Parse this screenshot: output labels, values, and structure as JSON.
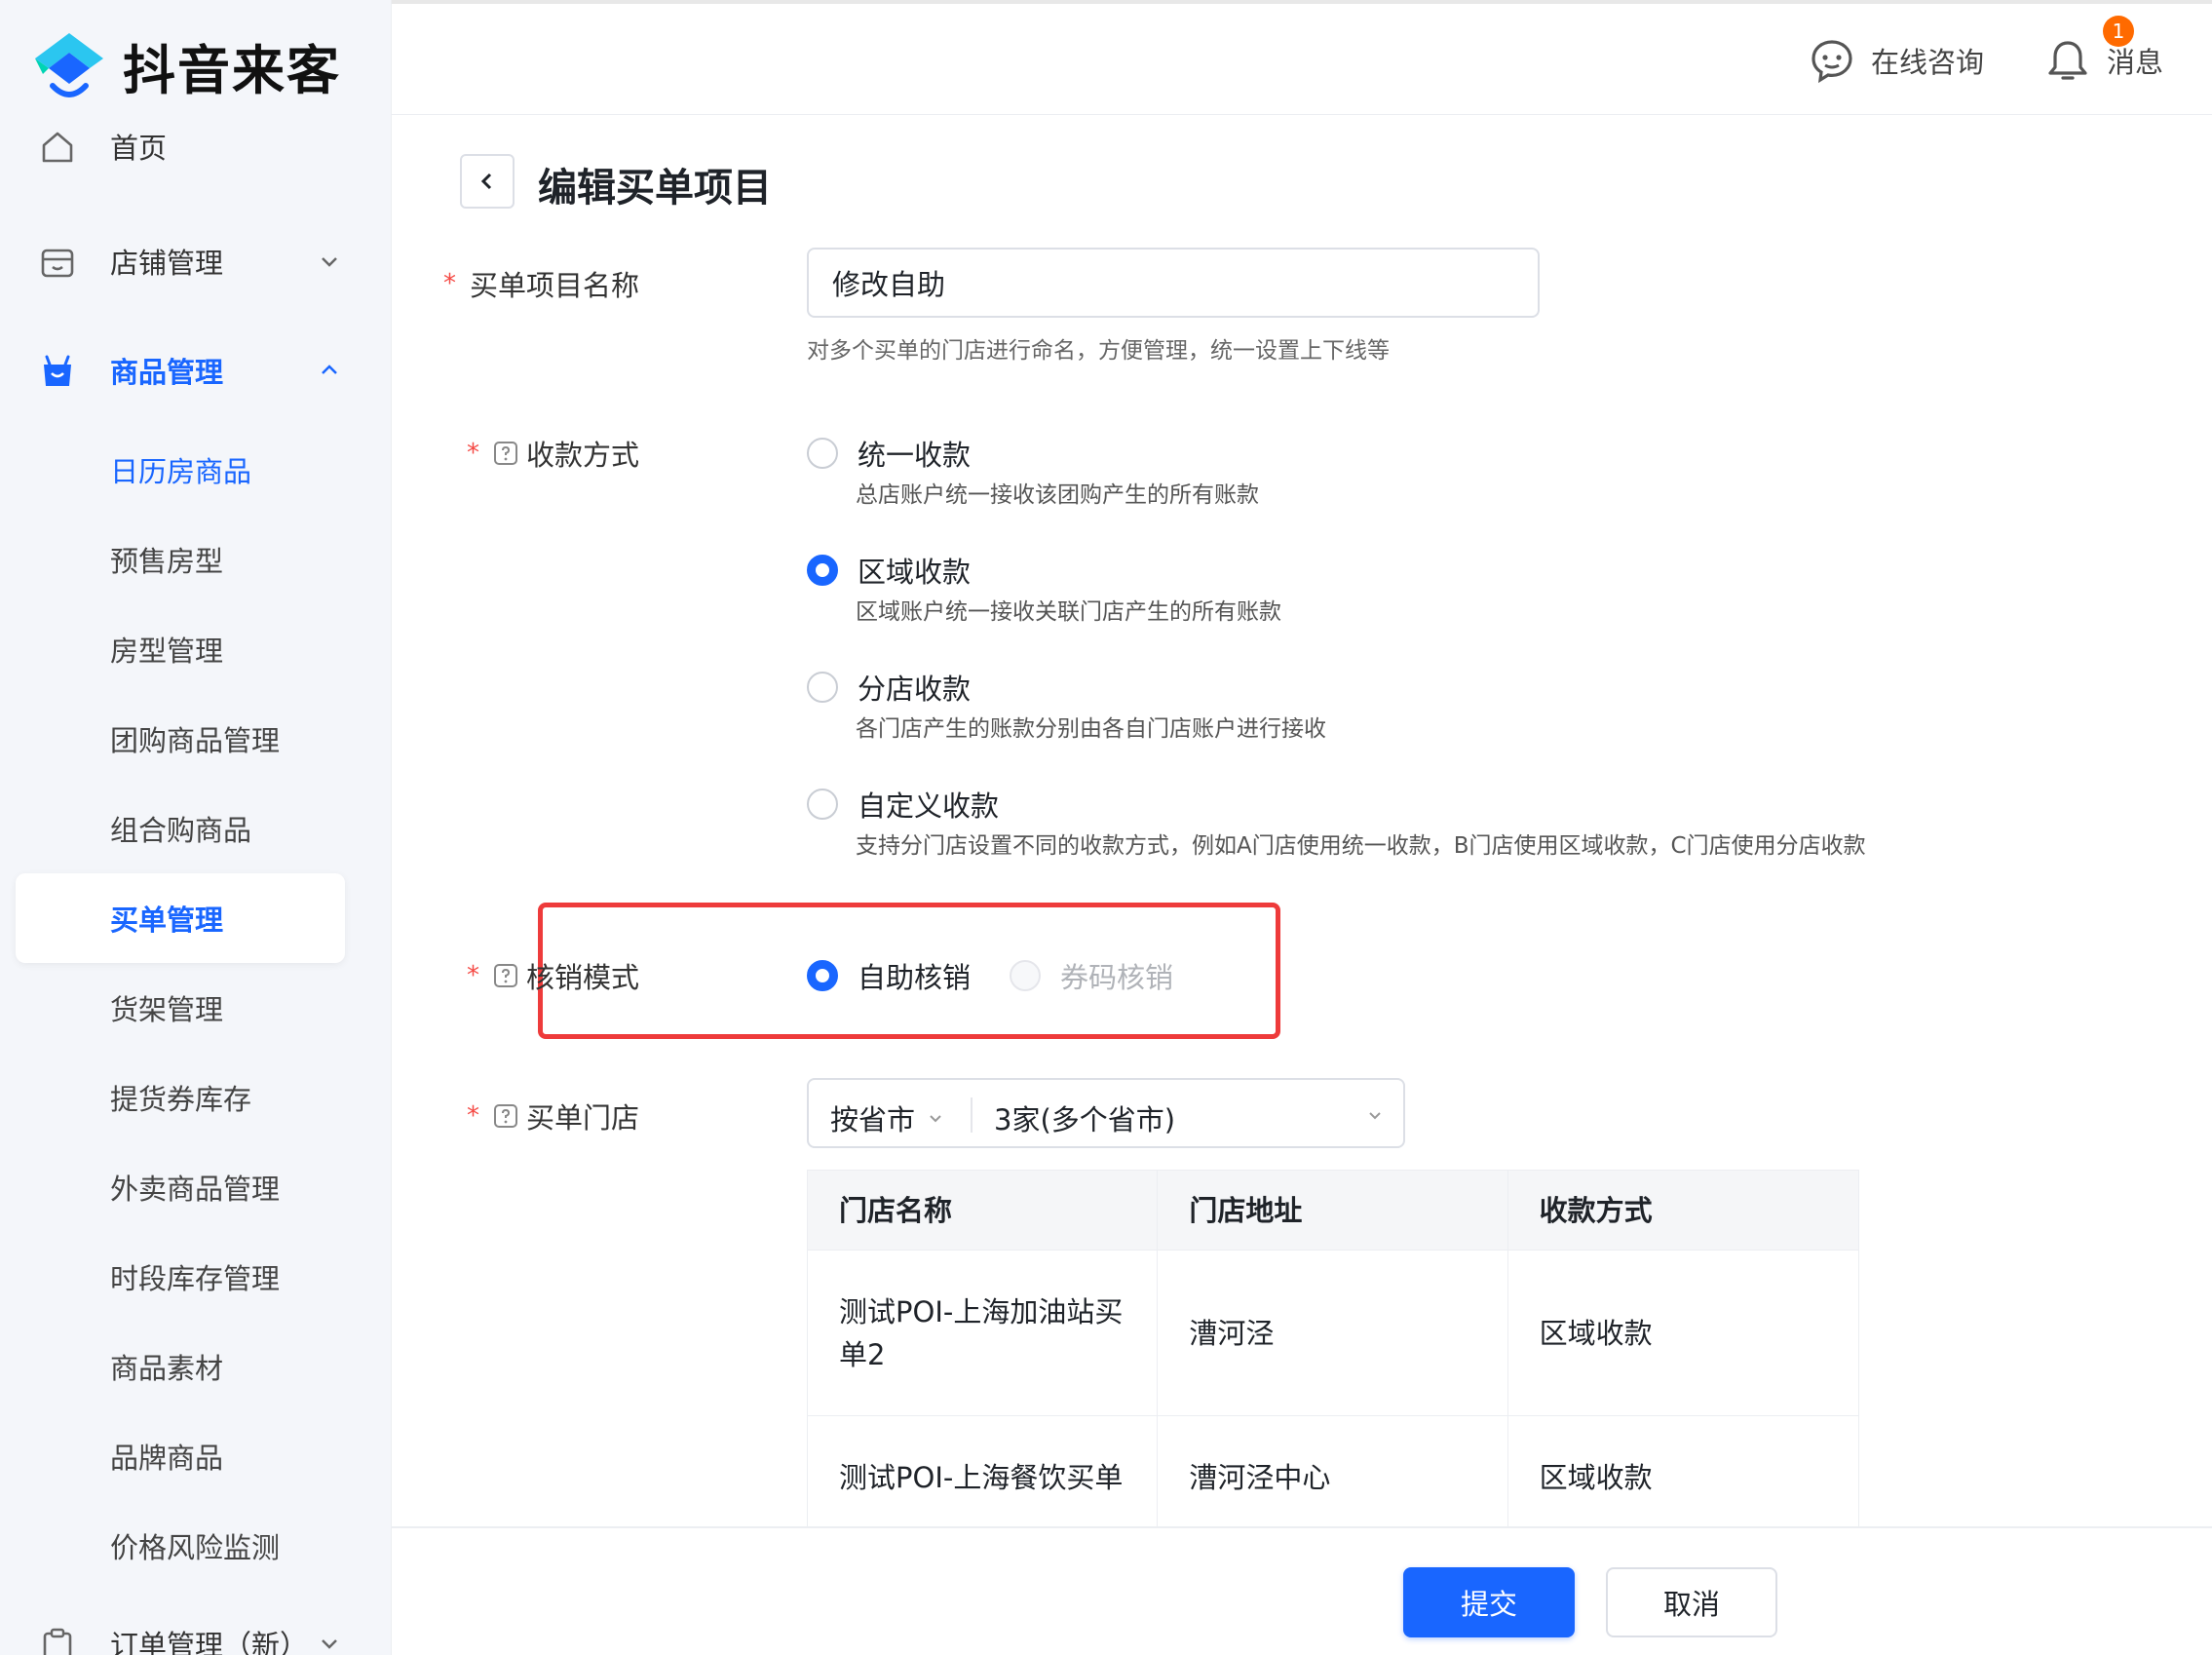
{
  "brand": {
    "name": "抖音来客"
  },
  "sidebar": {
    "items": [
      {
        "label": "首页",
        "icon": "home-icon"
      },
      {
        "label": "店铺管理",
        "icon": "store-icon"
      },
      {
        "label": "商品管理",
        "icon": "goods-bag-icon"
      }
    ],
    "sub_items": [
      "日历房商品",
      "预售房型",
      "房型管理",
      "团购商品管理",
      "组合购商品",
      "买单管理",
      "货架管理",
      "提货券库存",
      "外卖商品管理",
      "时段库存管理",
      "商品素材",
      "品牌商品",
      "价格风险监测"
    ],
    "order_item": {
      "label": "订单管理（新）"
    }
  },
  "header": {
    "consult_label": "在线咨询",
    "message_label": "消息",
    "message_badge": "1"
  },
  "page": {
    "title": "编辑买单项目"
  },
  "form": {
    "name": {
      "label": "买单项目名称",
      "value": "修改自助",
      "hint": "对多个买单的门店进行命名，方便管理，统一设置上下线等"
    },
    "payment": {
      "label": "收款方式",
      "options": [
        {
          "label": "统一收款",
          "desc": "总店账户统一接收该团购产生的所有账款"
        },
        {
          "label": "区域收款",
          "desc": "区域账户统一接收关联门店产生的所有账款"
        },
        {
          "label": "分店收款",
          "desc": "各门店产生的账款分别由各自门店账户进行接收"
        },
        {
          "label": "自定义收款",
          "desc": "支持分门店设置不同的收款方式，例如A门店使用统一收款，B门店使用区域收款，C门店使用分店收款"
        }
      ],
      "selected": "区域收款"
    },
    "verify": {
      "label": "核销模式",
      "options": [
        "自助核销",
        "券码核销"
      ],
      "selected": "自助核销"
    },
    "stores": {
      "label": "买单门店",
      "scope": "按省市",
      "summary": "3家(多个省市)"
    }
  },
  "store_table": {
    "columns": [
      "门店名称",
      "门店地址",
      "收款方式"
    ],
    "rows": [
      [
        "测试POI-上海加油站买单2",
        "漕河泾",
        "区域收款"
      ],
      [
        "测试POI-上海餐饮买单",
        "漕河泾中心",
        "区域收款"
      ]
    ]
  },
  "footer": {
    "submit_label": "提交",
    "cancel_label": "取消"
  },
  "colors": {
    "accent": "#1966ff",
    "highlight": "#ee3b3b",
    "badge": "#ff6a00"
  }
}
